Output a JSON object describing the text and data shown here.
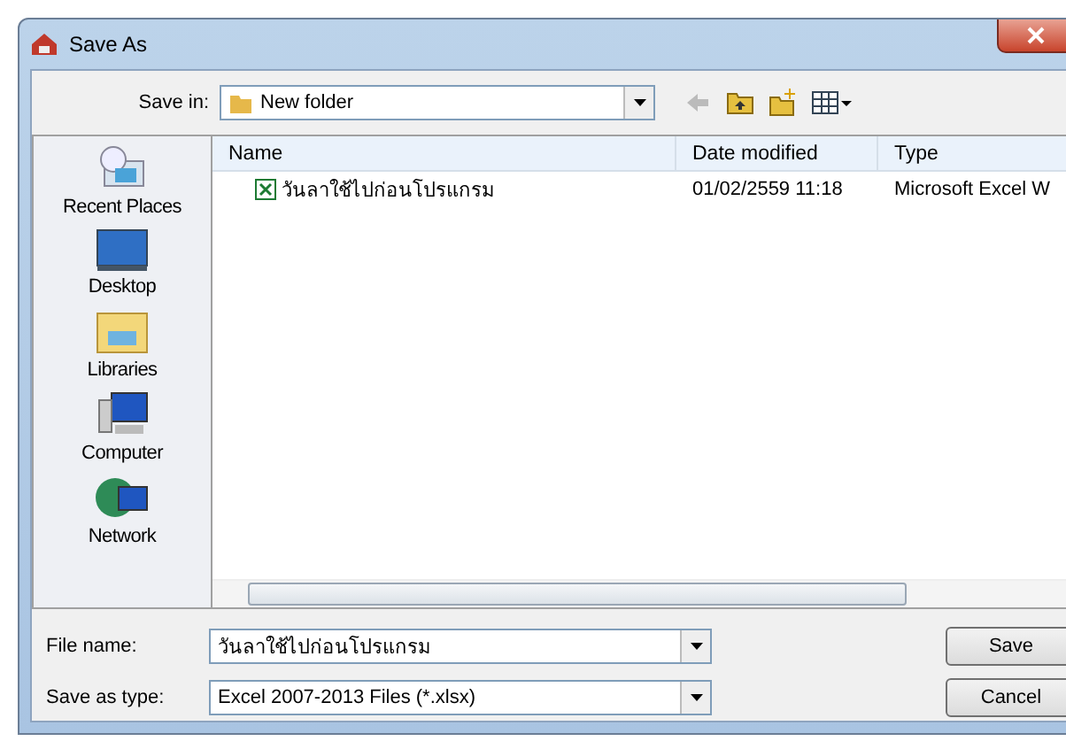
{
  "window": {
    "title": "Save As"
  },
  "save_in": {
    "label": "Save in:",
    "value": "New folder"
  },
  "places": [
    {
      "label": "Recent Places",
      "kind": "recent"
    },
    {
      "label": "Desktop",
      "kind": "desktop"
    },
    {
      "label": "Libraries",
      "kind": "libraries"
    },
    {
      "label": "Computer",
      "kind": "computer"
    },
    {
      "label": "Network",
      "kind": "network"
    }
  ],
  "table": {
    "columns": [
      "Name",
      "Date modified",
      "Type"
    ],
    "rows": [
      {
        "name": "วันลาใช้ไปก่อนโปรแกรม",
        "date": "01/02/2559 11:18",
        "type": "Microsoft Excel W"
      }
    ]
  },
  "file_name": {
    "label": "File name:",
    "value": "วันลาใช้ไปก่อนโปรแกรม"
  },
  "save_type": {
    "label": "Save as type:",
    "value": "Excel 2007-2013 Files (*.xlsx)"
  },
  "buttons": [
    "Save",
    "Cancel"
  ]
}
